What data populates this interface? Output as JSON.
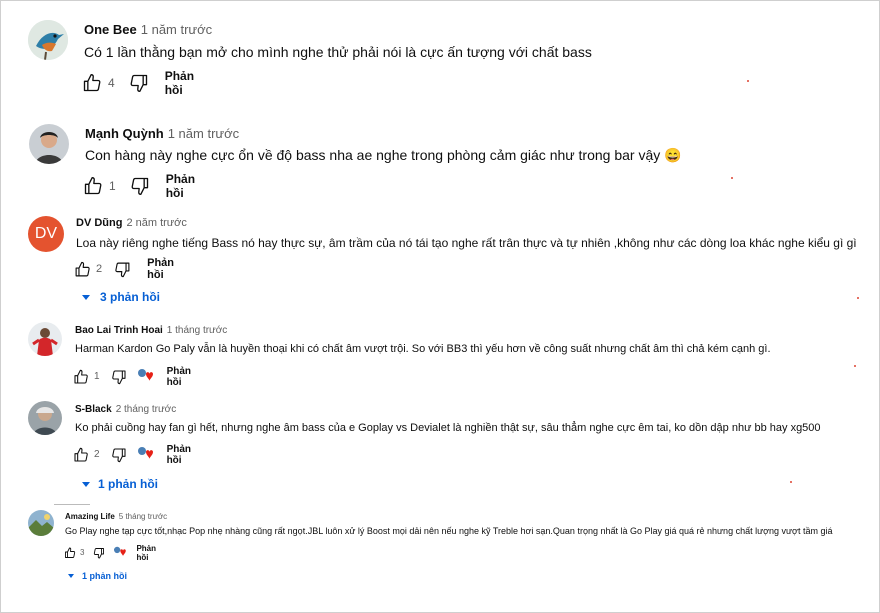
{
  "comments": [
    {
      "author": "One Bee",
      "time": "1 năm trước",
      "text": "Có 1 lần thằng bạn mở cho mình nghe thử phải nói là cực ấn tượng với chất bass",
      "likes": "4",
      "reply_label": "Phản hồi",
      "avatar_icon": "kingfisher-bird-avatar"
    },
    {
      "author": "Mạnh Quỳnh",
      "time": "1 năm trước",
      "text": "Con hàng này nghe cực ổn về độ bass nha ae nghe trong phòng cảm giác như trong bar vậy 😄",
      "likes": "1",
      "reply_label": "Phản hồi",
      "avatar_icon": "person-photo-avatar"
    },
    {
      "author": "DV Dũng",
      "time": "2 năm trước",
      "text": "Loa này riêng nghe tiếng Bass nó hay thực sự, âm trầm của nó tái tạo nghe rất trân thực và tự nhiên ,không như các dòng loa khác nghe kiểu gì gì",
      "likes": "2",
      "reply_label": "Phản hồi",
      "avatar_initials": "DV",
      "avatar_color": "#e4532f",
      "replies_label": "3 phản hồi"
    },
    {
      "author": "Bao Lai Trinh Hoai",
      "time": "1 tháng trước",
      "text": "Harman Kardon Go Paly vẫn là huyền thoại khi có chất âm vượt trội. So với BB3 thì yếu hơn về công suất nhưng chất âm  thì chả kém cạnh gì.",
      "likes": "1",
      "reply_label": "Phản hồi",
      "avatar_icon": "person-red-shirt-avatar"
    },
    {
      "author": "S-Black",
      "time": "2 tháng trước",
      "text": "Ko phải cuồng hay fan gì hết, nhưng nghe âm bass của e Goplay vs Devialet là nghiền thật sự, sâu thẳm nghe cực êm tai, ko dồn dập như bb hay xg500",
      "likes": "2",
      "reply_label": "Phản hồi",
      "avatar_icon": "person-photo-avatar",
      "replies_label": "1 phản hồi"
    },
    {
      "author": "Amazing Life",
      "time": "5 tháng trước",
      "text": "Go Play nghe tạp cực tốt,nhạc Pop nhẹ nhàng cũng rất ngọt.JBL luôn xử lý Boost mọi dải nên nếu nghe kỹ Treble hơi sạn.Quan trọng nhất là Go Play giá quá rẻ nhưng chất lượng vượt tầm giá",
      "likes": "3",
      "reply_label": "Phản hồi",
      "avatar_icon": "landscape-photo-avatar",
      "replies_label": "1 phản hồi"
    }
  ],
  "colors": {
    "link": "#065fd4",
    "secondary": "#606060",
    "heart": "#e62117"
  }
}
